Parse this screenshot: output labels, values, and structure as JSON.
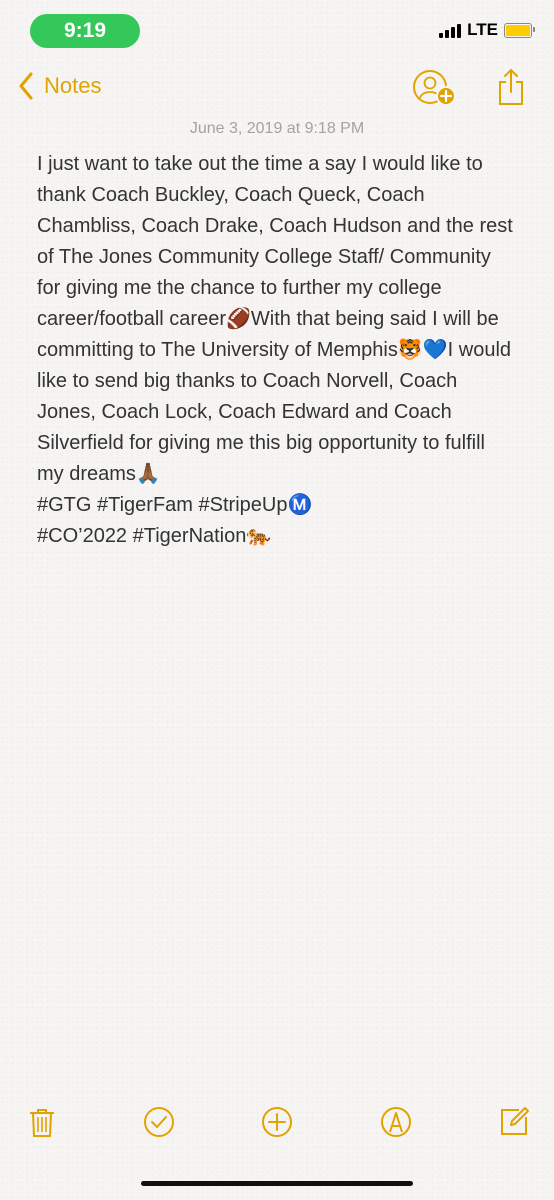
{
  "status_bar": {
    "time": "9:19",
    "network": "LTE",
    "battery_color": "#ffcc00",
    "time_pill_color": "#34c759"
  },
  "nav": {
    "back_label": "Notes",
    "back_icon": "chevron-left-icon",
    "collaborate_icon": "add-person-icon",
    "share_icon": "share-icon",
    "accent_color": "#e0a300"
  },
  "note": {
    "date": "June 3, 2019 at 9:18 PM",
    "body": "I just want to take out the time a say I would like to thank Coach Buckley, Coach Queck, Coach Chambliss, Coach Drake, Coach Hudson and the rest of The Jones Community College Staff/ Community for giving me the chance to further my college career/football career🏈With that being said I will be committing to The University of Memphis🐯💙I would like to send big thanks to Coach Norvell, Coach Jones, Coach Lock, Coach Edward and Coach Silverfield for giving me this big opportunity to fulfill my dreams🙏🏾\n#GTG #TigerFam #StripeUpⓂ️\n#CO’2022 #TigerNation🐅"
  },
  "toolbar": {
    "items": [
      "trash-icon",
      "checklist-icon",
      "add-icon",
      "markup-icon",
      "compose-icon"
    ]
  }
}
